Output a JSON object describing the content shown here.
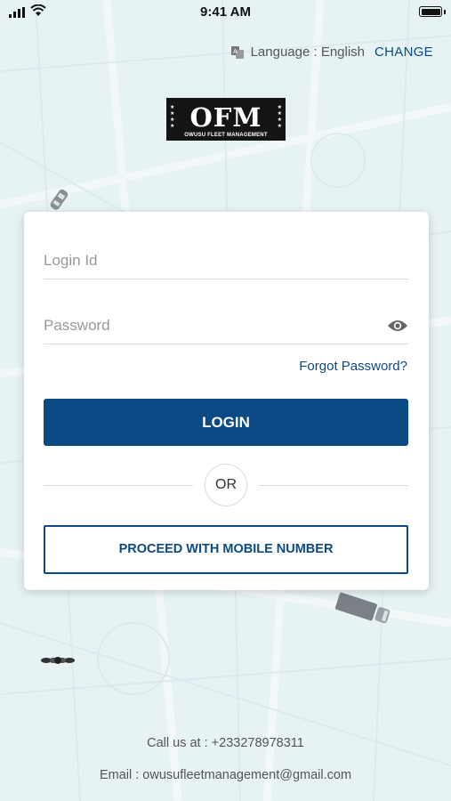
{
  "status_bar": {
    "time": "9:41 AM"
  },
  "language": {
    "label": "Language : English",
    "action": "CHANGE"
  },
  "logo": {
    "text": "OFM",
    "subtitle": "OWUSU FLEET MANAGEMENT"
  },
  "login_form": {
    "login_id_placeholder": "Login Id",
    "password_placeholder": "Password",
    "forgot_password": "Forgot Password?",
    "login_button": "LOGIN",
    "or_label": "OR",
    "mobile_button": "PROCEED WITH MOBILE NUMBER"
  },
  "footer": {
    "call": "Call us at : +233278978311",
    "email": "Email : owusufleetmanagement@gmail.com"
  },
  "colors": {
    "primary": "#0c4a86",
    "background": "#e6f2f4"
  }
}
